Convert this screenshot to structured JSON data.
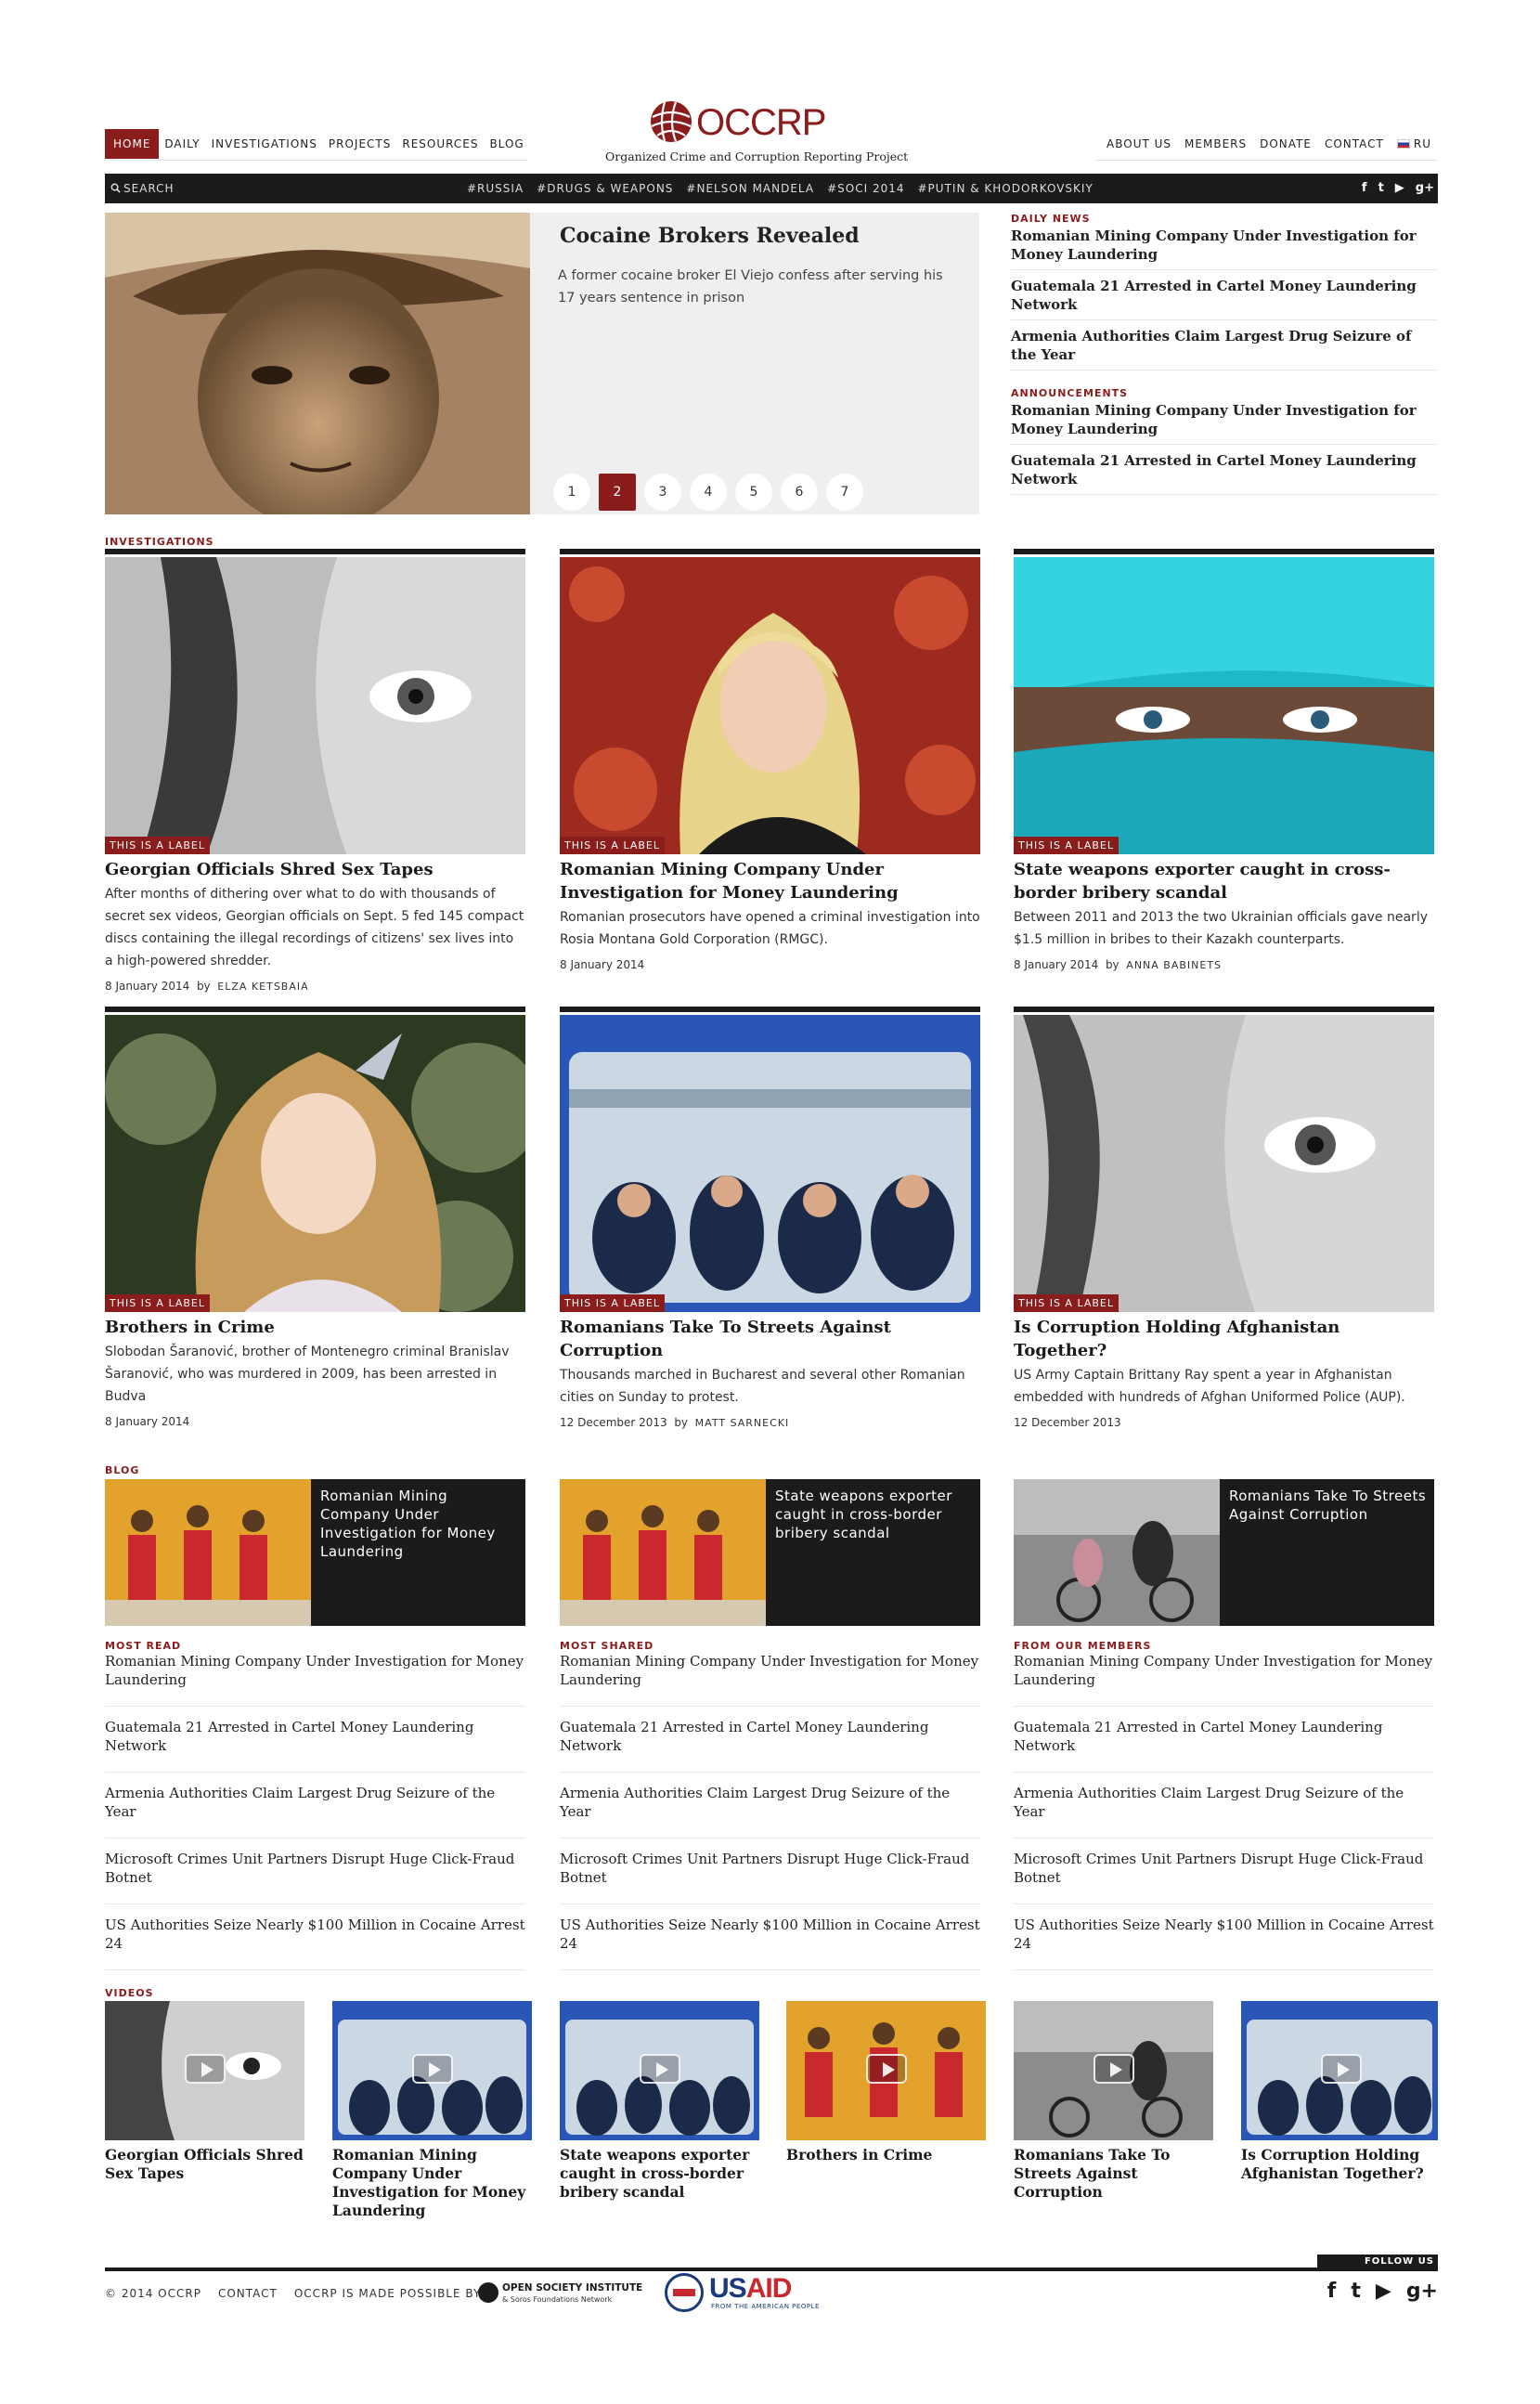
{
  "nav": {
    "left": [
      "HOME",
      "DAILY",
      "INVESTIGATIONS",
      "PROJECTS",
      "RESOURCES",
      "BLOG"
    ],
    "right": [
      "ABOUT US",
      "MEMBERS",
      "DONATE",
      "CONTACT",
      "RU"
    ]
  },
  "logo": {
    "word": "OCCRP",
    "tagline": "Organized Crime and Corruption Reporting Project"
  },
  "bar": {
    "search": "SEARCH",
    "tags": [
      "#RUSSIA",
      "#DRUGS & WEAPONS",
      "#NELSON MANDELA",
      "#SOCI 2014",
      "#PUTIN & KHODORKOVSKIY"
    ],
    "social": [
      "f",
      "t",
      "▶",
      "g+"
    ]
  },
  "hero": {
    "title": "Cocaine Brokers Revealed",
    "text": "A former cocaine broker El Viejo confess after serving his 17 years sentence in prison",
    "pages": [
      "1",
      "2",
      "3",
      "4",
      "5",
      "6",
      "7"
    ],
    "active_page": "2"
  },
  "side": {
    "daily_label": "DAILY NEWS",
    "daily": [
      "Romanian Mining Company Under Investigation for Money Laundering",
      "Guatemala 21 Arrested in Cartel Money Laundering Network",
      "Armenia Authorities Claim Largest Drug Seizure of the Year"
    ],
    "announce_label": "ANNOUNCEMENTS",
    "announce": [
      "Romanian Mining Company Under Investigation for Money Laundering",
      "Guatemala 21 Arrested in Cartel Money Laundering Network"
    ]
  },
  "sections": {
    "investigations": "INVESTIGATIONS",
    "blog": "BLOG",
    "videos": "VIDEOS"
  },
  "cards": [
    {
      "label": "THIS IS A LABEL",
      "title": "Georgian Officials Shred Sex Tapes",
      "text": "After months of dithering over what to do with thousands of secret sex videos, Georgian officials on Sept. 5 fed 145 compact discs containing the illegal recordings of citizens' sex lives into a high-powered shredder.",
      "date": "8 January 2014",
      "by": "by",
      "author": "ELZA KETSBAIA"
    },
    {
      "label": "THIS IS A LABEL",
      "title": "Romanian Mining Company Under Investigation for Money Laundering",
      "text": "Romanian prosecutors have opened a criminal investigation into Rosia Montana Gold Corporation (RMGC).",
      "date": "8 January 2014",
      "by": "",
      "author": ""
    },
    {
      "label": "THIS IS A LABEL",
      "title": "State weapons exporter caught in cross-border bribery scandal",
      "text": "Between 2011 and 2013 the two Ukrainian officials gave nearly $1.5 million in bribes to their Kazakh counterparts.",
      "date": "8 January 2014",
      "by": "by",
      "author": "ANNA BABINETS"
    },
    {
      "label": "THIS IS A LABEL",
      "title": "Brothers in Crime",
      "text": "Slobodan Šaranović, brother of Montenegro criminal Branislav Šaranović, who was murdered in 2009, has been arrested in Budva",
      "date": "8 January 2014",
      "by": "",
      "author": ""
    },
    {
      "label": "THIS IS A LABEL",
      "title": "Romanians Take To Streets Against Corruption",
      "text": "Thousands marched in Bucharest and several other Romanian cities on Sunday to protest.",
      "date": "12 December 2013",
      "by": "by",
      "author": "MATT SARNECKI"
    },
    {
      "label": "THIS IS A LABEL",
      "title": "Is Corruption Holding Afghanistan Together?",
      "text": "US Army Captain Brittany Ray spent a year in Afghanistan embedded with hundreds of Afghan Uniformed Police (AUP).",
      "date": "12 December 2013",
      "by": "",
      "author": ""
    }
  ],
  "blog": [
    "Romanian Mining Company Under Investigation for Money Laundering",
    "State weapons exporter caught in cross-border bribery scandal",
    "Romanians Take To Streets Against Corruption"
  ],
  "lists": [
    {
      "label": "MOST READ",
      "items": [
        "Romanian Mining Company Under Investigation for Money Laundering",
        "Guatemala 21 Arrested in Cartel Money Laundering Network",
        "Armenia Authorities Claim Largest Drug Seizure of the Year",
        "Microsoft Crimes Unit Partners Disrupt Huge Click-Fraud Botnet",
        "US Authorities Seize Nearly $100 Million in Cocaine Arrest 24"
      ]
    },
    {
      "label": "MOST SHARED",
      "items": [
        "Romanian Mining Company Under Investigation for Money Laundering",
        "Guatemala 21 Arrested in Cartel Money Laundering Network",
        "Armenia Authorities Claim Largest Drug Seizure of the Year",
        "Microsoft Crimes Unit Partners Disrupt Huge Click-Fraud Botnet",
        "US Authorities Seize Nearly $100 Million in Cocaine Arrest 24"
      ]
    },
    {
      "label": "FROM OUR MEMBERS",
      "items": [
        "Romanian Mining Company Under Investigation for Money Laundering",
        "Guatemala 21 Arrested in Cartel Money Laundering Network",
        "Armenia Authorities Claim Largest Drug Seizure of the Year",
        "Microsoft Crimes Unit Partners Disrupt Huge Click-Fraud Botnet",
        "US Authorities Seize Nearly $100 Million in Cocaine Arrest 24"
      ]
    }
  ],
  "videos": [
    "Georgian Officials Shred Sex Tapes",
    "Romanian Mining Company Under Investigation for Money Laundering",
    "State weapons exporter caught in cross-border bribery scandal",
    "Brothers in Crime",
    "Romanians Take To Streets Against Corruption",
    "Is Corruption Holding Afghanistan Together?"
  ],
  "footer": {
    "follow": "FOLLOW US",
    "copyright": "© 2014 OCCRP",
    "contact": "CONTACT",
    "possible": "OCCRP IS MADE POSSIBLE BY",
    "osi_name": "OPEN SOCIETY INSTITUTE",
    "osi_sub": "& Soros Foundations Network",
    "usaid_us": "US",
    "usaid_aid": "AID",
    "usaid_sub": "FROM THE AMERICAN PEOPLE",
    "social": [
      "f",
      "t",
      "▶",
      "g+"
    ]
  },
  "colors": {
    "accent": "#8a1c1c",
    "dark": "#1c1a1b"
  }
}
